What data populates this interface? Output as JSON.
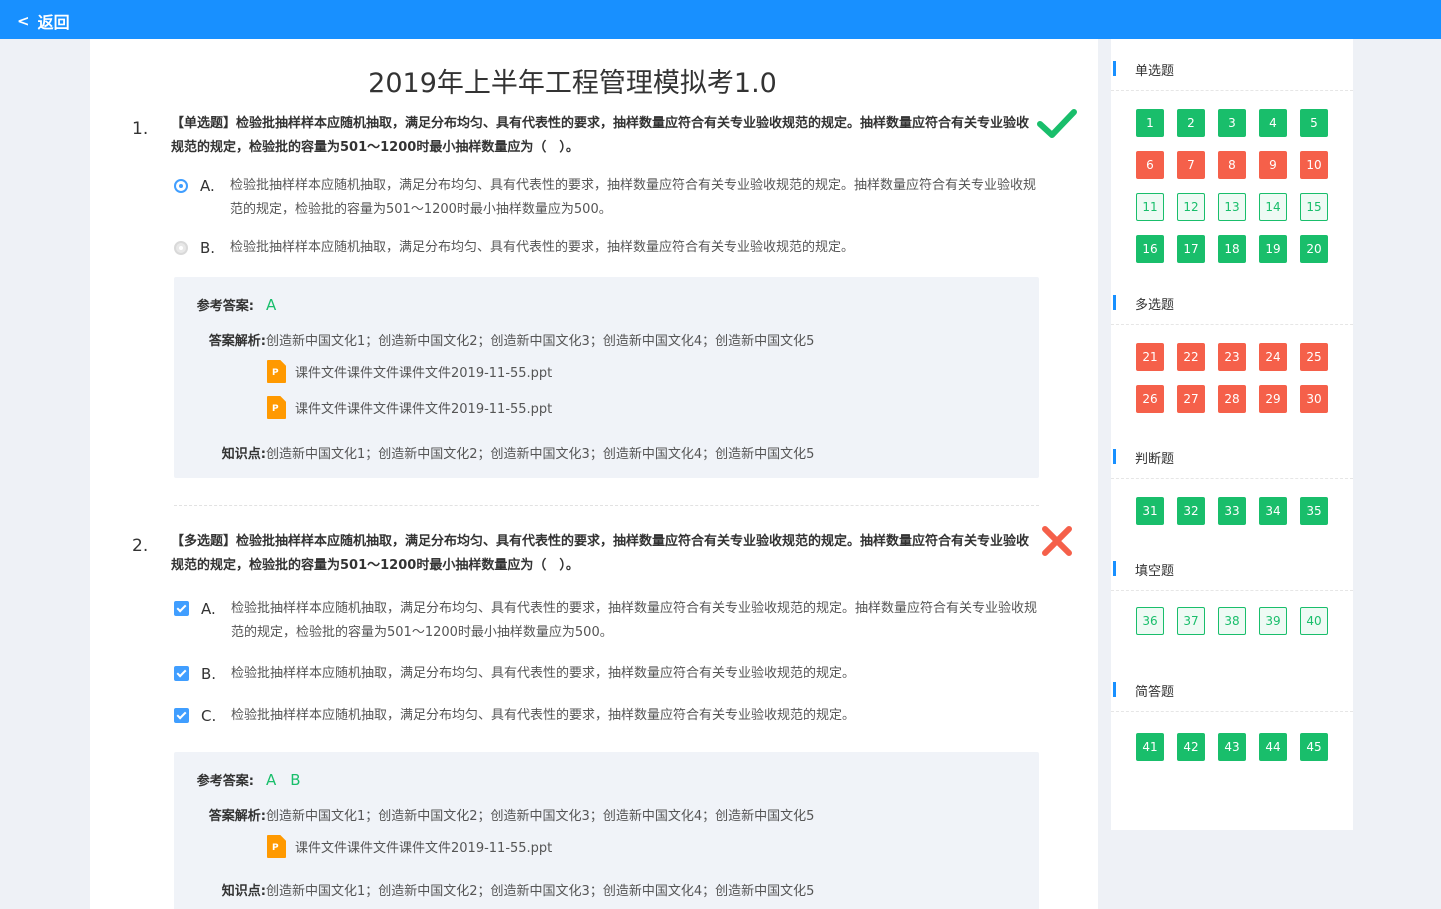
{
  "nav": {
    "back_label": "返回"
  },
  "exam": {
    "title": "2019年上半年工程管理模拟考1.0"
  },
  "questions": [
    {
      "number": "1.",
      "stem": "【单选题】检验批抽样样本应随机抽取，满足分布均匀、具有代表性的要求，抽样数量应符合有关专业验收规范的规定。抽样数量应符合有关专业验收规范的规定，检验批的容量为501～1200时最小抽样数量应为（　）。",
      "result_icon": "checkmark-icon",
      "options": [
        {
          "letter": "A.",
          "text": "检验批抽样样本应随机抽取，满足分布均匀、具有代表性的要求，抽样数量应符合有关专业验收规范的规定。抽样数量应符合有关专业验收规范的规定，检验批的容量为501～1200时最小抽样数量应为500。"
        },
        {
          "letter": "B.",
          "text": "检验批抽样样本应随机抽取，满足分布均匀、具有代表性的要求，抽样数量应符合有关专业验收规范的规定。"
        }
      ],
      "answer_label": "参考答案:",
      "answer_values": [
        "A"
      ],
      "analysis_label": "答案解析:",
      "analysis_text": "创造新中国文化1；创造新中国文化2；创造新中国文化3；创造新中国文化4；创造新中国文化5",
      "files": [
        {
          "icon": "P",
          "name": "课件文件课件文件课件文件2019-11-55.ppt"
        },
        {
          "icon": "P",
          "name": "课件文件课件文件课件文件2019-11-55.ppt"
        }
      ],
      "knowledge_label": "知识点:",
      "knowledge_text": "创造新中国文化1；创造新中国文化2；创造新中国文化3；创造新中国文化4；创造新中国文化5"
    },
    {
      "number": "2.",
      "stem": "【多选题】检验批抽样样本应随机抽取，满足分布均匀、具有代表性的要求，抽样数量应符合有关专业验收规范的规定。抽样数量应符合有关专业验收规范的规定，检验批的容量为501～1200时最小抽样数量应为（　）。",
      "result_icon": "cross-icon",
      "options": [
        {
          "letter": "A.",
          "text": "检验批抽样样本应随机抽取，满足分布均匀、具有代表性的要求，抽样数量应符合有关专业验收规范的规定。抽样数量应符合有关专业验收规范的规定，检验批的容量为501～1200时最小抽样数量应为500。"
        },
        {
          "letter": "B.",
          "text": "检验批抽样样本应随机抽取，满足分布均匀、具有代表性的要求，抽样数量应符合有关专业验收规范的规定。"
        },
        {
          "letter": "C.",
          "text": "检验批抽样样本应随机抽取，满足分布均匀、具有代表性的要求，抽样数量应符合有关专业验收规范的规定。"
        }
      ],
      "answer_label": "参考答案:",
      "answer_values": [
        "A",
        "B"
      ],
      "analysis_label": "答案解析:",
      "analysis_text": "创造新中国文化1；创造新中国文化2；创造新中国文化3；创造新中国文化4；创造新中国文化5",
      "files": [
        {
          "icon": "P",
          "name": "课件文件课件文件课件文件2019-11-55.ppt"
        }
      ],
      "knowledge_label": "知识点:",
      "knowledge_text": "创造新中国文化1；创造新中国文化2；创造新中国文化3；创造新中国文化4；创造新中国文化5"
    }
  ],
  "sidebar": {
    "colors": {
      "correct": "#19be6b",
      "wrong": "#f5604a",
      "blank": "#eefaf4",
      "accent": "#1890ff"
    },
    "sections": [
      {
        "label": "单选题",
        "rows": [
          [
            {
              "n": "1",
              "s": "correct"
            },
            {
              "n": "2",
              "s": "correct"
            },
            {
              "n": "3",
              "s": "correct"
            },
            {
              "n": "4",
              "s": "correct"
            },
            {
              "n": "5",
              "s": "correct"
            }
          ],
          [
            {
              "n": "6",
              "s": "wrong"
            },
            {
              "n": "7",
              "s": "wrong"
            },
            {
              "n": "8",
              "s": "wrong"
            },
            {
              "n": "9",
              "s": "wrong"
            },
            {
              "n": "10",
              "s": "wrong"
            }
          ],
          [
            {
              "n": "11",
              "s": "blank"
            },
            {
              "n": "12",
              "s": "blank"
            },
            {
              "n": "13",
              "s": "blank"
            },
            {
              "n": "14",
              "s": "blank"
            },
            {
              "n": "15",
              "s": "blank"
            }
          ],
          [
            {
              "n": "16",
              "s": "correct"
            },
            {
              "n": "17",
              "s": "correct"
            },
            {
              "n": "18",
              "s": "correct"
            },
            {
              "n": "19",
              "s": "correct"
            },
            {
              "n": "20",
              "s": "correct"
            }
          ]
        ]
      },
      {
        "label": "多选题",
        "rows": [
          [
            {
              "n": "21",
              "s": "wrong"
            },
            {
              "n": "22",
              "s": "wrong"
            },
            {
              "n": "23",
              "s": "wrong"
            },
            {
              "n": "24",
              "s": "wrong"
            },
            {
              "n": "25",
              "s": "wrong"
            }
          ],
          [
            {
              "n": "26",
              "s": "wrong"
            },
            {
              "n": "27",
              "s": "wrong"
            },
            {
              "n": "28",
              "s": "wrong"
            },
            {
              "n": "29",
              "s": "wrong"
            },
            {
              "n": "30",
              "s": "wrong"
            }
          ]
        ]
      },
      {
        "label": "判断题",
        "rows": [
          [
            {
              "n": "31",
              "s": "correct"
            },
            {
              "n": "32",
              "s": "correct"
            },
            {
              "n": "33",
              "s": "correct"
            },
            {
              "n": "34",
              "s": "correct"
            },
            {
              "n": "35",
              "s": "correct"
            }
          ]
        ]
      },
      {
        "label": "填空题",
        "rows": [
          [
            {
              "n": "36",
              "s": "blank"
            },
            {
              "n": "37",
              "s": "blank"
            },
            {
              "n": "38",
              "s": "blank"
            },
            {
              "n": "39",
              "s": "blank"
            },
            {
              "n": "40",
              "s": "blank"
            }
          ]
        ]
      },
      {
        "label": "简答题",
        "rows": [
          [
            {
              "n": "41",
              "s": "correct"
            },
            {
              "n": "42",
              "s": "correct"
            },
            {
              "n": "43",
              "s": "correct"
            },
            {
              "n": "44",
              "s": "correct"
            },
            {
              "n": "45",
              "s": "correct"
            }
          ]
        ]
      }
    ]
  }
}
